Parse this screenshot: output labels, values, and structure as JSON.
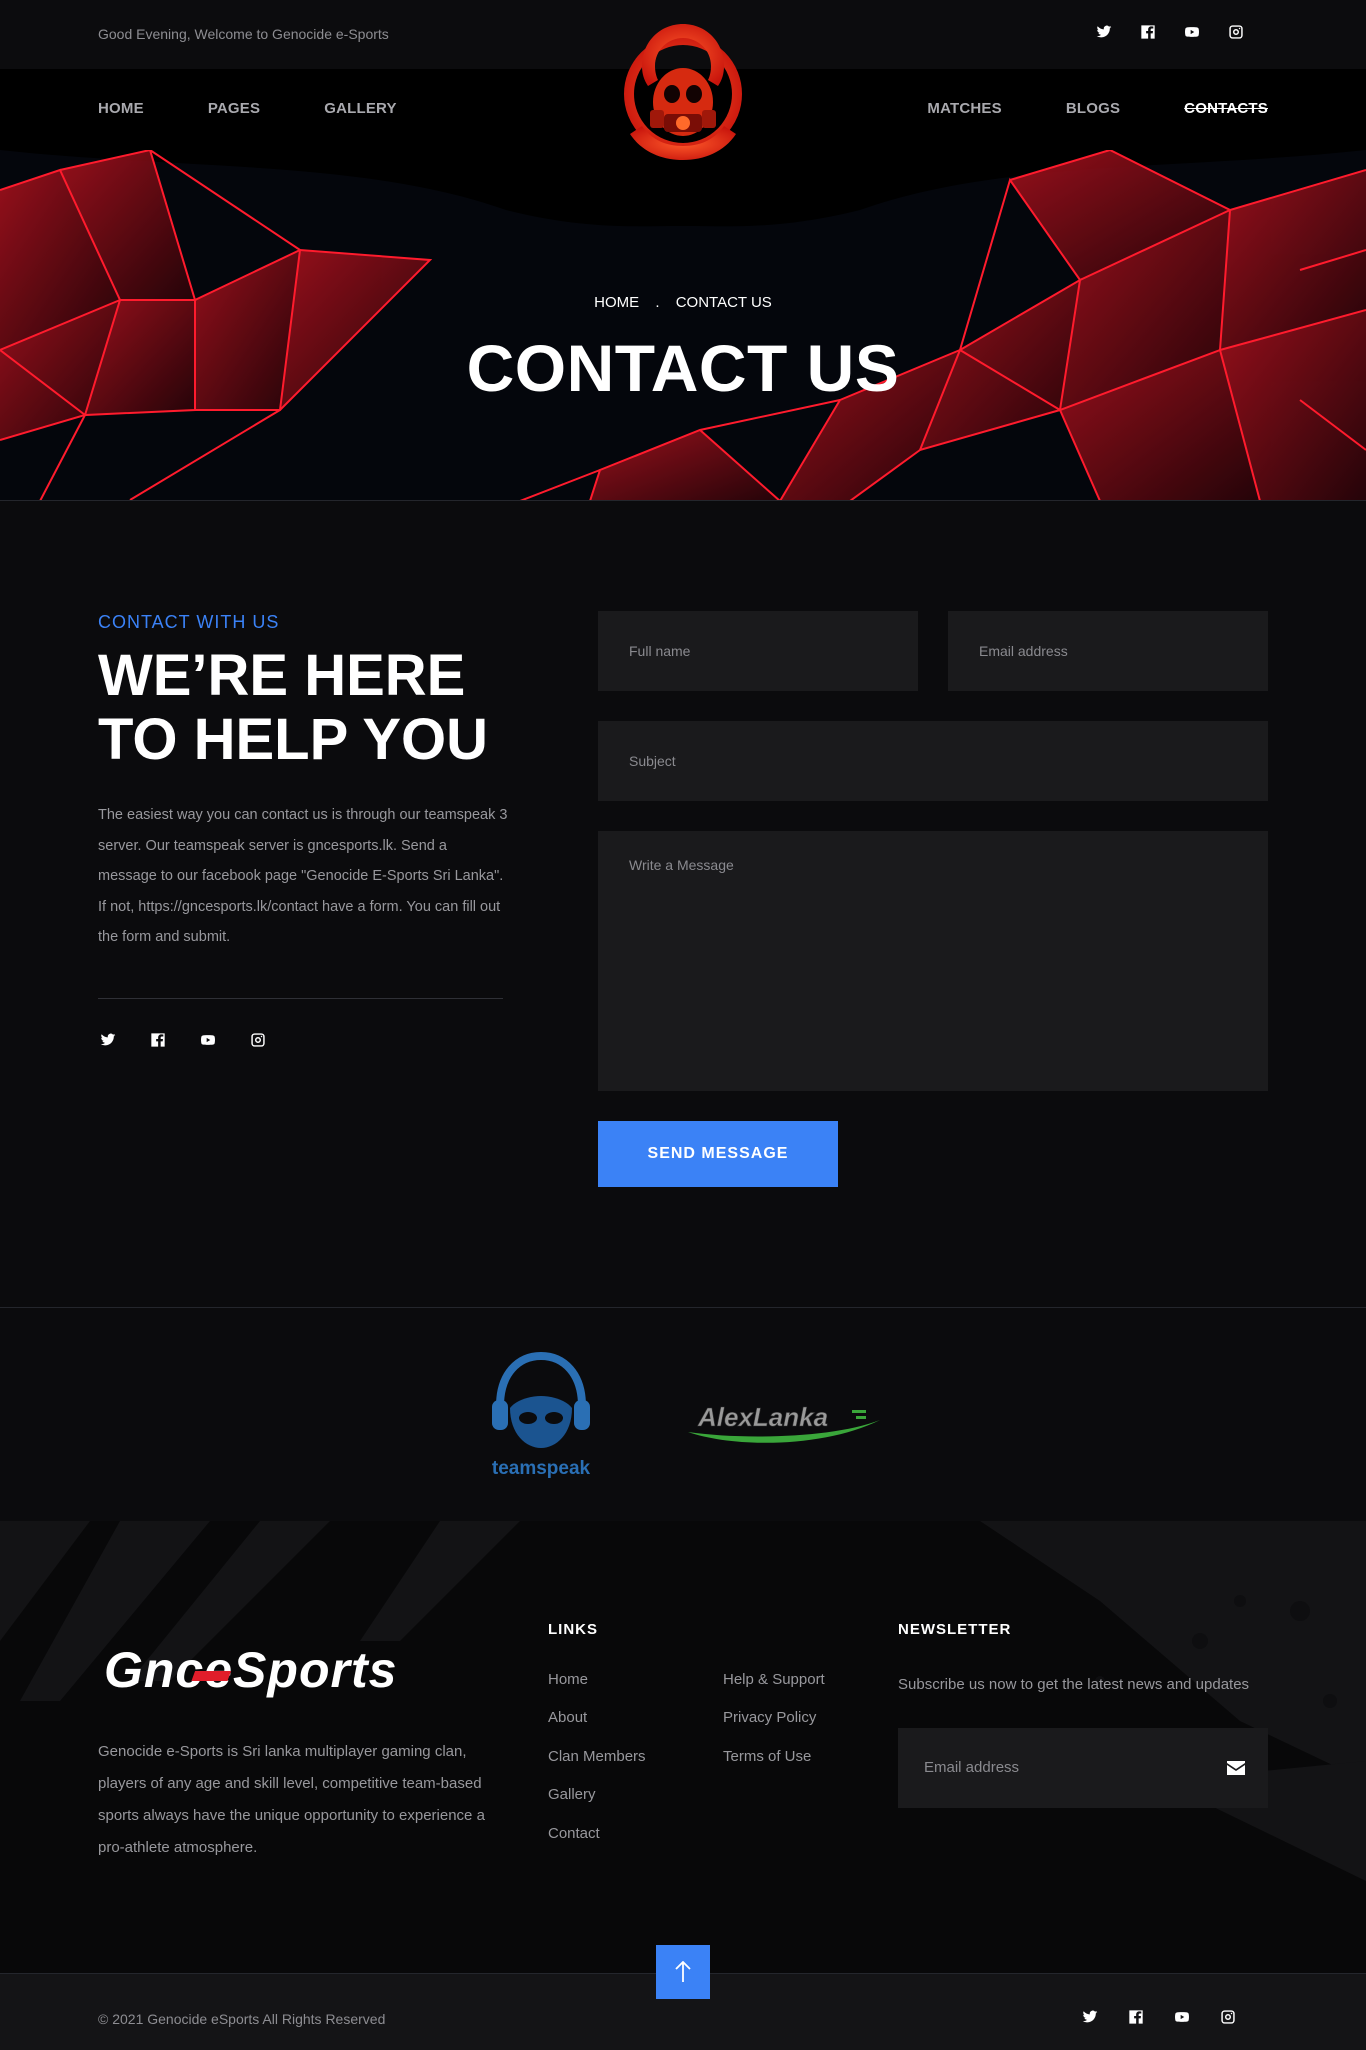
{
  "topbar": {
    "greeting": "Good Evening, Welcome to Genocide e-Sports",
    "social": [
      "twitter-icon",
      "facebook-icon",
      "youtube-icon",
      "instagram-icon"
    ]
  },
  "nav": {
    "left": [
      {
        "label": "HOME"
      },
      {
        "label": "PAGES"
      },
      {
        "label": "GALLERY"
      }
    ],
    "right": [
      {
        "label": "MATCHES"
      },
      {
        "label": "BLOGS"
      },
      {
        "label": "CONTACTS",
        "active": true
      }
    ]
  },
  "hero": {
    "breadcrumb_home": "HOME",
    "breadcrumb_sep": ".",
    "breadcrumb_current": "CONTACT US",
    "title": "CONTACT US"
  },
  "contact": {
    "kicker": "CONTACT WITH US",
    "headline": "WE’RE HERE TO HELP YOU",
    "description": "The easiest way you can contact us is through our teamspeak 3 server. Our teamspeak server is gncesports.lk. Send a message to our facebook page \"Genocide E-Sports Sri Lanka\". If not, https://gncesports.lk/contact have a form. You can fill out the form and submit.",
    "form": {
      "full_name_placeholder": "Full name",
      "email_placeholder": "Email address",
      "subject_placeholder": "Subject",
      "message_placeholder": "Write a Message",
      "submit_label": "SEND MESSAGE"
    }
  },
  "partners": {
    "teamspeak_label": "teamspeak",
    "alexlanka_label": "AlexLanka"
  },
  "footer": {
    "logo_text": "GnceSports",
    "description": "Genocide e-Sports is Sri lanka multiplayer gaming clan, players of any age and skill level, competitive team-based sports always have the unique opportunity to experience a pro-athlete atmosphere.",
    "links_title": "LINKS",
    "links_col1": [
      "Home",
      "About",
      "Clan Members",
      "Gallery",
      "Contact"
    ],
    "links_col2": [
      "Help & Support",
      "Privacy Policy",
      "Terms of Use"
    ],
    "newsletter_title": "NEWSLETTER",
    "newsletter_text": "Subscribe us now to get the latest news and updates",
    "newsletter_placeholder": "Email address",
    "copyright": "© 2021 Genocide eSports All Rights Reserved"
  },
  "colors": {
    "accent": "#3b82f6",
    "brand_red": "#e11d2a",
    "background": "#0b0b0d",
    "field": "#1a1a1c"
  }
}
